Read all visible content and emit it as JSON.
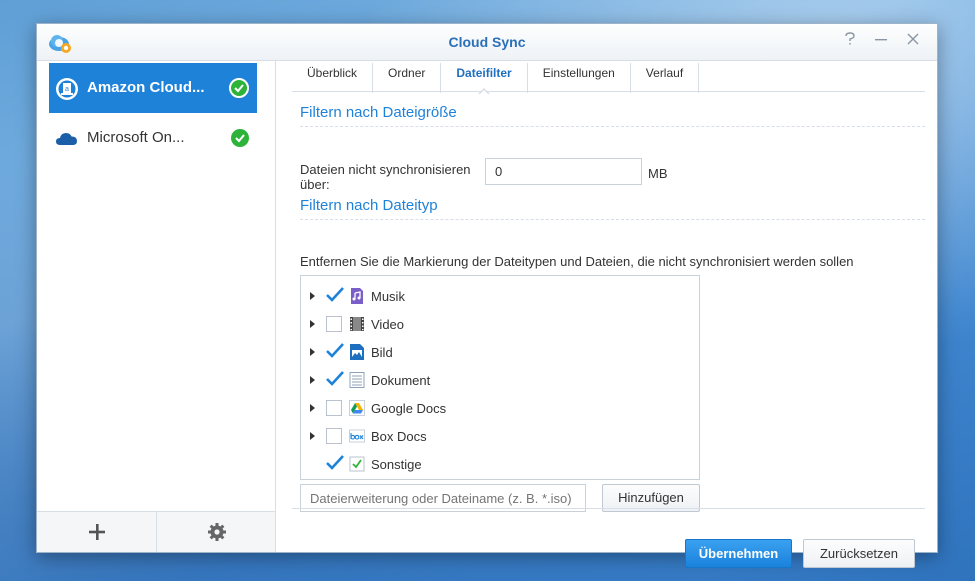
{
  "window": {
    "title": "Cloud Sync"
  },
  "sidebar": {
    "accounts": [
      {
        "label": "Amazon Cloud...",
        "selected": true,
        "status": "ok"
      },
      {
        "label": "Microsoft On...",
        "selected": false,
        "status": "ok"
      }
    ],
    "footer": {
      "add_icon": "plus-icon",
      "settings_icon": "gear-icon"
    }
  },
  "tabs": [
    {
      "label": "Überblick"
    },
    {
      "label": "Ordner"
    },
    {
      "label": "Dateifilter",
      "active": true
    },
    {
      "label": "Einstellungen"
    },
    {
      "label": "Verlauf"
    }
  ],
  "size_filter": {
    "title": "Filtern nach Dateigröße",
    "label": "Dateien nicht synchronisieren über:",
    "value": "0",
    "unit": "MB"
  },
  "type_filter": {
    "title": "Filtern nach Dateityp",
    "description": "Entfernen Sie die Markierung der Dateitypen und Dateien, die nicht synchronisiert werden sollen",
    "items": [
      {
        "label": "Musik",
        "checked": true,
        "expandable": true,
        "icon": "music-file-icon"
      },
      {
        "label": "Video",
        "checked": false,
        "expandable": true,
        "icon": "video-file-icon"
      },
      {
        "label": "Bild",
        "checked": true,
        "expandable": true,
        "icon": "image-file-icon"
      },
      {
        "label": "Dokument",
        "checked": true,
        "expandable": true,
        "icon": "document-file-icon"
      },
      {
        "label": "Google Docs",
        "checked": false,
        "expandable": true,
        "icon": "google-drive-icon"
      },
      {
        "label": "Box Docs",
        "checked": false,
        "expandable": true,
        "icon": "box-icon"
      },
      {
        "label": "Sonstige",
        "checked": true,
        "expandable": false,
        "icon": "other-file-icon"
      }
    ],
    "add_placeholder": "Dateierweiterung oder Dateiname (z. B. *.iso)",
    "add_button": "Hinzufügen"
  },
  "actions": {
    "apply": "Übernehmen",
    "reset": "Zurücksetzen"
  },
  "colors": {
    "accent": "#1f82d9",
    "ok": "#2db33a"
  }
}
